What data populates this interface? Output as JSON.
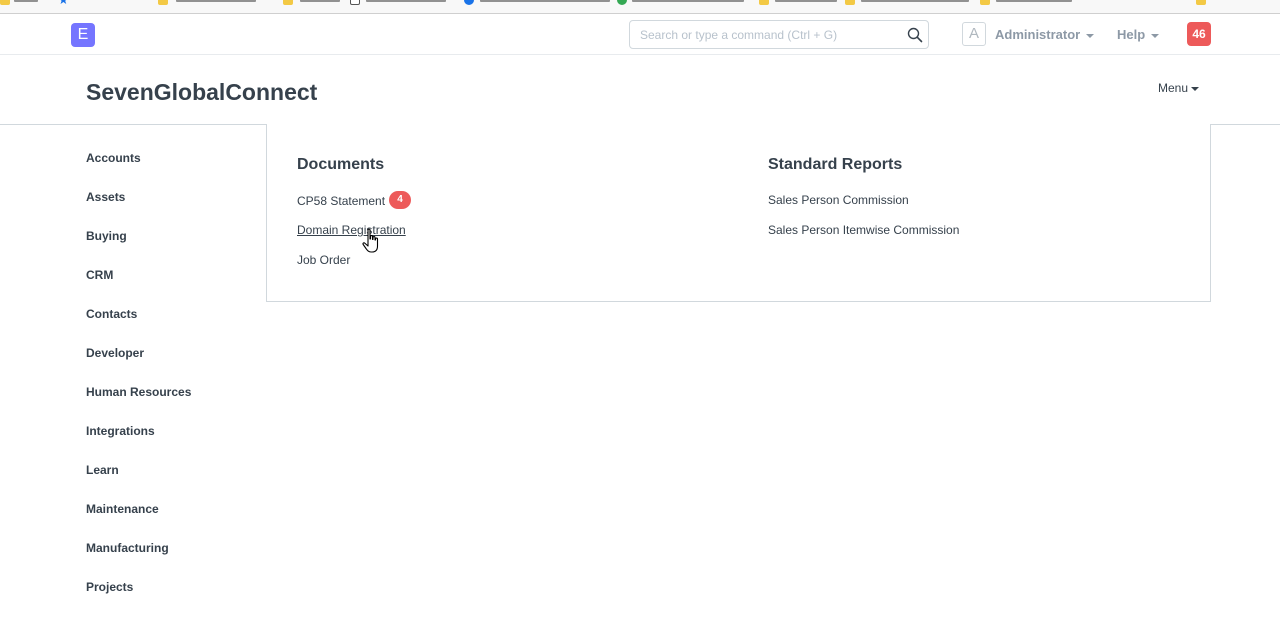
{
  "navbar": {
    "logo_letter": "E",
    "search_placeholder": "Search or type a command (Ctrl + G)",
    "avatar_letter": "A",
    "user_label": "Administrator",
    "help_label": "Help",
    "notification_count": "46"
  },
  "page": {
    "title": "SevenGlobalConnect",
    "menu_label": "Menu"
  },
  "sidebar": {
    "items": [
      {
        "label": "Accounts"
      },
      {
        "label": "Assets"
      },
      {
        "label": "Buying"
      },
      {
        "label": "CRM"
      },
      {
        "label": "Contacts"
      },
      {
        "label": "Developer"
      },
      {
        "label": "Human Resources"
      },
      {
        "label": "Integrations"
      },
      {
        "label": "Learn"
      },
      {
        "label": "Maintenance"
      },
      {
        "label": "Manufacturing"
      },
      {
        "label": "Projects"
      }
    ]
  },
  "main": {
    "documents": {
      "heading": "Documents",
      "items": [
        {
          "label": "CP58 Statement",
          "badge": "4"
        },
        {
          "label": "Domain Registration"
        },
        {
          "label": "Job Order"
        }
      ]
    },
    "standard_reports": {
      "heading": "Standard Reports",
      "items": [
        {
          "label": "Sales Person Commission"
        },
        {
          "label": "Sales Person Itemwise Commission"
        }
      ]
    }
  },
  "colors": {
    "logo_bg": "#7575ff",
    "badge_red": "#ed5a5a",
    "text_dark": "#36414c",
    "text_muted": "#8d99a6",
    "border": "#d1d8dd"
  }
}
